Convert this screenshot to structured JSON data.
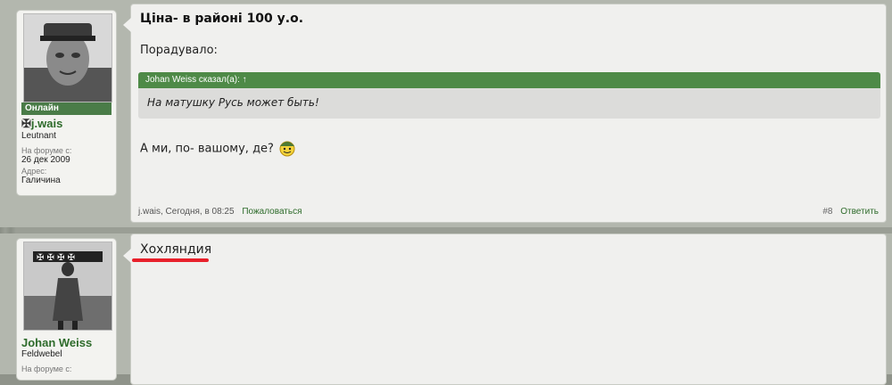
{
  "post1": {
    "user": {
      "status": "Онлайн",
      "name": "j.wais",
      "rank": "Leutnant",
      "joined_label": "На форуме с:",
      "joined_value": "26 дек 2009",
      "location_label": "Адрес:",
      "location_value": "Галичина"
    },
    "title": "Ціна- в районі 100 у.о.",
    "line1": "Порадувало:",
    "quote_author": "Johan Weiss сказал(а): ↑",
    "quote_text": "На матушку Русь может быть!",
    "line2": "А ми, по- вашому, де?",
    "footer": {
      "meta": "j.wais, Сегодня, в 08:25",
      "report": "Пожаловаться",
      "number": "#8",
      "reply": "Ответить"
    }
  },
  "post2": {
    "user": {
      "name": "Johan Weiss",
      "rank": "Feldwebel",
      "joined_label": "На форуме с:"
    },
    "text": "Хохляндия"
  },
  "colors": {
    "accent_green": "#4e8a47",
    "link_green": "#2e6b2b",
    "highlight_red": "#e8202a"
  },
  "icons": {
    "iron_cross": "iron-cross-icon",
    "smiley": "soldier-smiley-icon"
  }
}
